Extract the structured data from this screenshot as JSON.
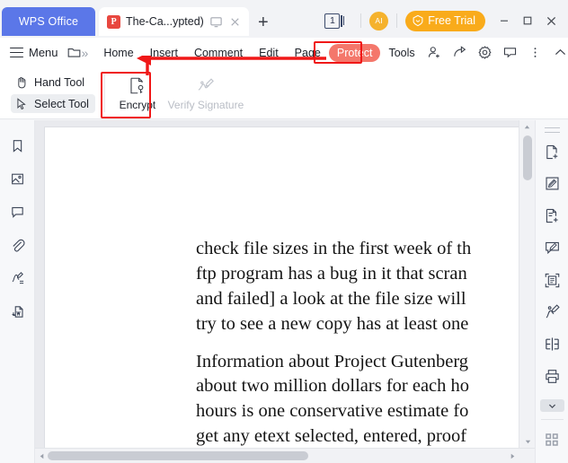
{
  "app": {
    "brand": "WPS Office"
  },
  "titlebar": {
    "tab": {
      "title": "The-Ca...ypted)",
      "file_type": "PDF",
      "icon": "pdf-icon",
      "monitor_icon": "monitor-icon",
      "close_icon": "close-icon"
    },
    "new_tab_label": "+",
    "page_count": "1",
    "ai_label": "AI",
    "free_trial_label": "Free Trial",
    "window_controls": {
      "minimize": "–",
      "maximize": "□",
      "close": "✕"
    },
    "colors": {
      "brand_blue": "#5b77e8",
      "pdf_red": "#e8473f",
      "trial_orange": "#f9ab1b",
      "ai_orange": "#f5b22d"
    }
  },
  "ribbon": {
    "menu_label": "Menu",
    "open_icon": "folder-open-icon",
    "more_icon": "chevron-double-right-icon",
    "tabs": [
      {
        "label": "Home",
        "active": false
      },
      {
        "label": "Insert",
        "active": false
      },
      {
        "label": "Comment",
        "active": false
      },
      {
        "label": "Edit",
        "active": false
      },
      {
        "label": "Page",
        "active": false
      },
      {
        "label": "Protect",
        "active": true
      },
      {
        "label": "Tools",
        "active": false
      }
    ],
    "active_tab_color": "#f4776b",
    "right_icons": [
      "add-user-icon",
      "share-icon",
      "settings-gear-icon",
      "feedback-icon",
      "more-vertical-icon",
      "collapse-ribbon-icon"
    ]
  },
  "toolbar": {
    "hand_tool_label": "Hand Tool",
    "select_tool_label": "Select Tool",
    "select_tool_selected": true,
    "encrypt_label": "Encrypt",
    "verify_signature_label": "Verify Signature",
    "verify_signature_disabled": true
  },
  "left_rail": {
    "items": [
      {
        "icon": "bookmark-icon"
      },
      {
        "icon": "image-icon"
      },
      {
        "icon": "comment-icon"
      },
      {
        "icon": "attachment-icon"
      },
      {
        "icon": "signature-icon"
      },
      {
        "icon": "export-to-word-icon"
      }
    ]
  },
  "right_rail": {
    "items": [
      {
        "icon": "new-document-icon"
      },
      {
        "icon": "edit-document-icon"
      },
      {
        "icon": "add-page-icon"
      },
      {
        "icon": "comment-edit-icon"
      },
      {
        "icon": "ocr-scan-icon"
      },
      {
        "icon": "annotate-pen-icon"
      },
      {
        "icon": "split-view-icon"
      },
      {
        "icon": "print-icon"
      }
    ],
    "expand_icon": "chevron-down-icon",
    "grid_icon": "grid-apps-icon"
  },
  "document": {
    "paragraphs": [
      "check file sizes in the first week of th\nftp program has a bug in it that scran\nand failed] a look at the file size will\ntry to see a new copy has at least one",
      "Information about Project Gutenberg\nabout two million dollars for each ho\nhours is one conservative estimate fo\nget any etext selected, entered, proof"
    ],
    "lines_1": [
      "check file sizes in the first week of th",
      "ftp program has a bug in it that scran",
      "and failed] a look at the file size will",
      "try to see a new copy has at least one"
    ],
    "lines_2": [
      "Information about Project Gutenberg",
      "about two million dollars for each ho",
      "hours is one conservative estimate fo",
      "get any etext selected, entered, proof"
    ]
  },
  "annotations": {
    "color": "#f01818",
    "highlight_protect_tab": true,
    "highlight_encrypt_button": true,
    "arrow_from": "Protect",
    "arrow_to": "Encrypt"
  }
}
